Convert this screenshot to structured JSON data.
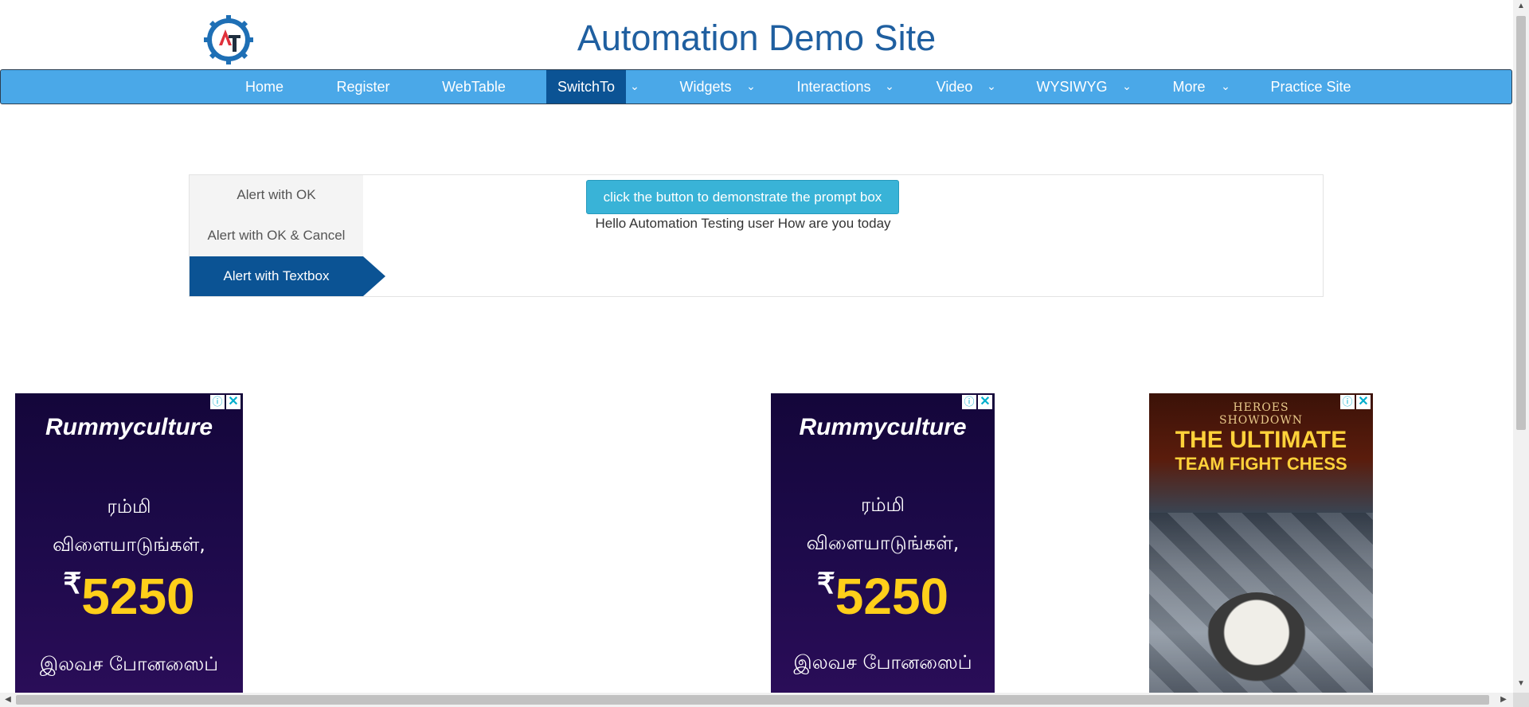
{
  "header": {
    "title": "Automation Demo Site",
    "logo_text": "AT"
  },
  "nav": {
    "items": [
      {
        "label": "Home",
        "has_dropdown": false,
        "active": false
      },
      {
        "label": "Register",
        "has_dropdown": false,
        "active": false
      },
      {
        "label": "WebTable",
        "has_dropdown": false,
        "active": false
      },
      {
        "label": "SwitchTo",
        "has_dropdown": true,
        "active": true
      },
      {
        "label": "Widgets",
        "has_dropdown": true,
        "active": false
      },
      {
        "label": "Interactions",
        "has_dropdown": true,
        "active": false
      },
      {
        "label": "Video",
        "has_dropdown": true,
        "active": false
      },
      {
        "label": "WYSIWYG",
        "has_dropdown": true,
        "active": false
      },
      {
        "label": "More",
        "has_dropdown": true,
        "active": false
      },
      {
        "label": "Practice Site",
        "has_dropdown": false,
        "active": false
      }
    ],
    "caret": "⌄"
  },
  "alerts": {
    "tabs": [
      {
        "label": "Alert with OK",
        "active": false
      },
      {
        "label": "Alert with OK & Cancel",
        "active": false
      },
      {
        "label": "Alert with Textbox",
        "active": true
      }
    ],
    "button_label": "click the button to demonstrate the prompt box",
    "result_text": "Hello Automation Testing user How are you today"
  },
  "ads": {
    "info_glyph": "ⓘ",
    "close_glyph": "✕",
    "rummy": {
      "brand": "Rummyculture",
      "line1": "ரம்மி",
      "line2": "விளையாடுங்கள்,",
      "currency": "₹",
      "amount": "5250",
      "line3": "இலவச போனஸைப்"
    },
    "game": {
      "brand_line1": "HEROES",
      "brand_line2": "SHOWDOWN",
      "headline1": "THE ULTIMATE",
      "headline2": "TEAM FIGHT CHESS"
    }
  },
  "colors": {
    "nav_bg": "#4aa8e8",
    "nav_active": "#0b5394",
    "title": "#1f5fa0",
    "button": "#39b3d7"
  }
}
